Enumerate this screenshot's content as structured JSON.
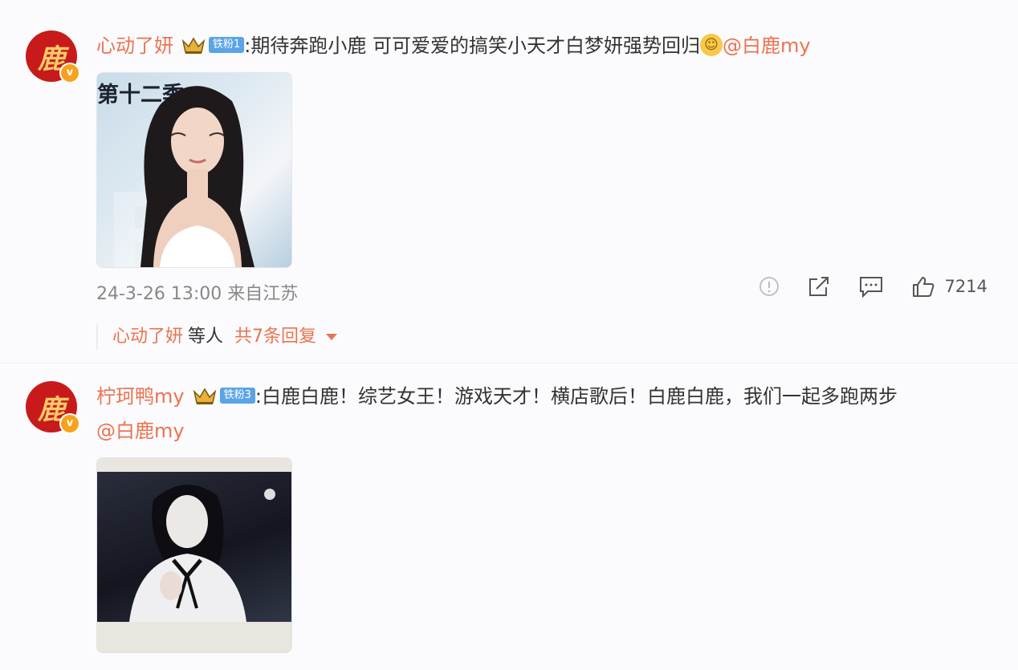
{
  "comments": [
    {
      "avatar_char": "鹿",
      "username": "心动了妍",
      "fan_badge": "铁粉1",
      "text": ":期待奔跑小鹿 可可爱爱的搞笑小天才白梦妍强势回归",
      "mention": "@白鹿my",
      "image_text": "第十二季",
      "timestamp": "24-3-26 13:00",
      "location": "来自江苏",
      "like_count": "7214",
      "replies": {
        "who": "心动了妍",
        "etc": "等人",
        "total": "共7条回复"
      }
    },
    {
      "avatar_char": "鹿",
      "username": "柠珂鸭my",
      "fan_badge": "铁粉3",
      "text": ":白鹿白鹿！综艺女王！游戏天才！横店歌后！白鹿白鹿，我们一起多跑两步",
      "mention": "@白鹿my"
    }
  ],
  "colors": {
    "username": "#eb7350",
    "fan_badge": "#5aa4e6",
    "avatar_bg": "#c81a1a",
    "verified": "#f7a21c"
  },
  "icons": [
    "report-icon",
    "share-icon",
    "comment-icon",
    "like-icon",
    "crown-icon",
    "smile-emoji-icon",
    "chevron-down-icon"
  ]
}
